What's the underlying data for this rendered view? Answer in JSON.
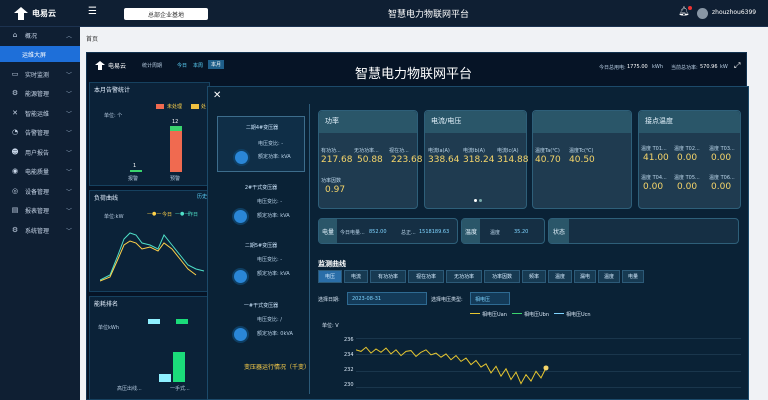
{
  "topbar": {
    "logo": "电易云",
    "org": "总部企业基地",
    "title": "智慧电力物联网平台",
    "user": "zhouzhou6399"
  },
  "sidebar": {
    "items": [
      {
        "label": "概况",
        "icon": "home-icon"
      },
      {
        "label": "运维大屏",
        "icon": ""
      },
      {
        "label": "实时监测",
        "icon": "monitor-icon"
      },
      {
        "label": "能源管理",
        "icon": "energy-icon"
      },
      {
        "label": "智能运维",
        "icon": "wrench-icon"
      },
      {
        "label": "告警管理",
        "icon": "bell-icon"
      },
      {
        "label": "用户报告",
        "icon": "report-icon"
      },
      {
        "label": "电能质量",
        "icon": "quality-icon"
      },
      {
        "label": "设备管理",
        "icon": "device-icon"
      },
      {
        "label": "报表管理",
        "icon": "table-icon"
      },
      {
        "label": "系统管理",
        "icon": "settings-icon"
      }
    ]
  },
  "breadcrumb": "首页",
  "dash": {
    "logo": "电易云",
    "stat": "统计周期",
    "today": "今日",
    "week": "本周",
    "month": "本月",
    "title": "智慧电力物联网平台",
    "today_power_label": "今日总用电:",
    "today_power": "1775.00",
    "unit_kwh": "kWh",
    "cur_power_label": "当前总功率:",
    "cur_power": "570.96",
    "unit_kw": "kW",
    "alarm_panel": {
      "title": "本月告警统计",
      "legend1": "未处理",
      "legend2": "处",
      "unit": "单位: 个",
      "bar1": "1",
      "bar2": "12",
      "x1": "报警",
      "x2": "预警"
    },
    "load_panel": {
      "title": "负荷曲线",
      "tag": "历史",
      "unit": "单位:kW",
      "legend1": "今日",
      "legend2": "昨日"
    },
    "energy_panel": {
      "title": "能耗排名",
      "unit": "单位kWh",
      "x1": "高压出线...",
      "x2": "一手式..."
    }
  },
  "overlay": {
    "transformers": [
      {
        "name": "二期4#变压器",
        "voltage": "电压变比: -",
        "capacity": "额定功率: kVA"
      },
      {
        "name": "2#干式变压器",
        "voltage": "电压变比: -",
        "capacity": "额定功率: kVA"
      },
      {
        "name": "二期5#变压器",
        "voltage": "电压变比: -",
        "capacity": "额定功率: kVA"
      },
      {
        "name": "一#干式变压器",
        "voltage": "电压变比: /",
        "capacity": "额定功率: 0kVA"
      }
    ],
    "footer": "变压器运行情况（千变）",
    "power": {
      "title": "功率",
      "l1": "有功功...",
      "l2": "无功功率...",
      "l3": "视在功...",
      "v1": "217.68",
      "v2": "50.88",
      "v3": "223.68",
      "l4": "功率因数",
      "v4": "0.97"
    },
    "current": {
      "title": "电流/电压",
      "l1": "电流Ia(A)",
      "l2": "电流Ib(A)",
      "l3": "电流Ic(A)",
      "v1": "338.64",
      "v2": "318.24",
      "v3": "314.88"
    },
    "temp": {
      "l1": "温度Ta(℃)",
      "l2": "温度Tc(℃)",
      "v1": "40.70",
      "v2": "40.50"
    },
    "contact": {
      "title": "接点温度",
      "l1": "温度 T01...",
      "l2": "温度 T02...",
      "l3": "温度 T03...",
      "v1": "41.00",
      "v2": "0.00",
      "v3": "0.00",
      "l4": "温度 T04...",
      "l5": "温度 T05...",
      "l6": "温度 T06...",
      "v4": "0.00",
      "v5": "0.00",
      "v6": "0.00"
    },
    "energy": {
      "label": "电量",
      "today": "今日电量...",
      "today_val": "852.00",
      "total": "总正...",
      "total_val": "1518189.63"
    },
    "temperature": {
      "label": "温度",
      "inner": "温度",
      "val": "35.20"
    },
    "state": {
      "label": "状态"
    },
    "monitor_title": "监测曲线",
    "tabs": [
      "电压",
      "电流",
      "有功功率",
      "视在功率",
      "无功功率",
      "功率因数",
      "频率",
      "温度",
      "漏电",
      "温度",
      "电量"
    ],
    "date_label": "选择日期:",
    "date": "2023-08-31",
    "type_label": "选择电压类型:",
    "type": "相电压",
    "unit": "单位: V",
    "legend": [
      "相电压Uan",
      "相电压Ubn",
      "相电压Ucn"
    ],
    "yticks": [
      "236",
      "234",
      "232",
      "230"
    ]
  },
  "chart_data": {
    "type": "line",
    "ylabel": "单位: V",
    "ylim": [
      229,
      237
    ],
    "series": [
      {
        "name": "相电压Uan",
        "values": [
          234.6,
          234.4,
          234.9,
          234.2,
          234.7,
          234.3,
          234.8,
          234.1,
          234.6,
          233.9,
          234.4,
          234.5,
          233.8,
          234.3,
          234.6,
          234.0,
          234.2,
          233.7,
          234.1,
          233.4,
          233.9,
          233.2,
          233.6,
          232.8,
          233.3,
          232.5,
          232.9,
          231.8,
          232.6,
          231.4,
          232.3,
          231.0,
          231.9,
          230.5,
          231.6,
          230.8,
          232.0,
          231.2,
          232.4
        ]
      }
    ]
  }
}
